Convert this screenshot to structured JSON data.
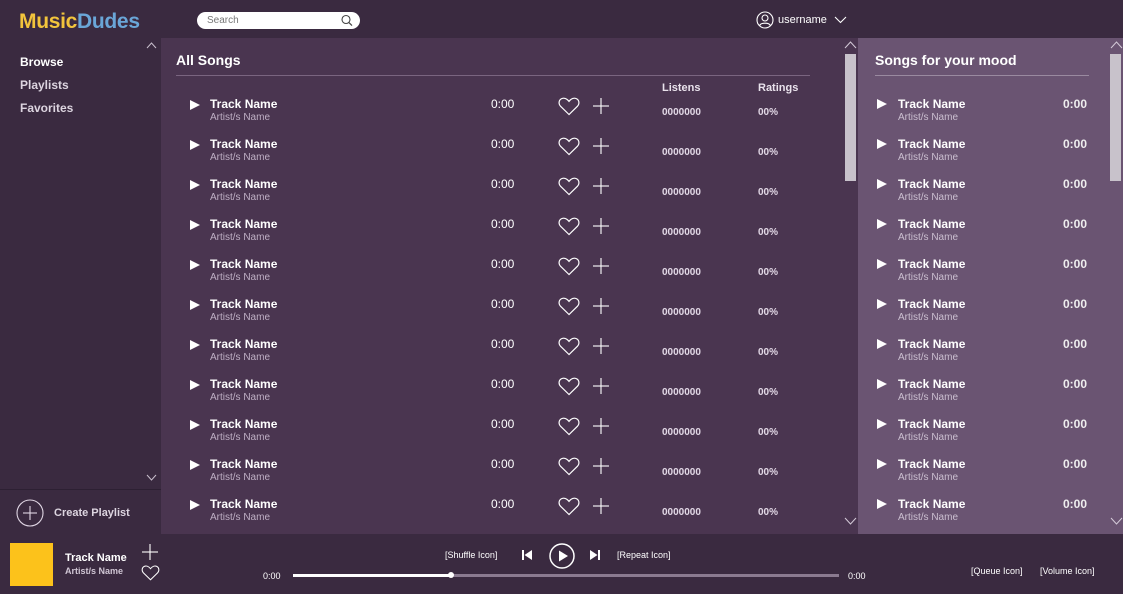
{
  "app": {
    "logo_part1": "Music",
    "logo_part2": "Dudes"
  },
  "colors": {
    "logo_music": "#f2c43c",
    "logo_dudes": "#6aa6d8",
    "album_art": "#fcc21b",
    "main_bg": "#4a3550",
    "mood_bg": "#6a5472"
  },
  "search": {
    "placeholder": "Search",
    "icon": "search-icon"
  },
  "user": {
    "name": "username",
    "icon": "user-icon"
  },
  "sidebar": {
    "items": [
      {
        "label": "Browse",
        "active": true
      },
      {
        "label": "Playlists",
        "active": false
      },
      {
        "label": "Favorites",
        "active": false
      }
    ],
    "create_label": "Create Playlist"
  },
  "main": {
    "title": "All Songs",
    "columns": {
      "listens": "Listens",
      "ratings": "Ratings"
    },
    "rows": [
      {
        "track": "Track Name",
        "artist": "Artist/s Name",
        "duration": "0:00",
        "listens": "0000000",
        "rating": "00%"
      },
      {
        "track": "Track Name",
        "artist": "Artist/s Name",
        "duration": "0:00",
        "listens": "0000000",
        "rating": "00%"
      },
      {
        "track": "Track Name",
        "artist": "Artist/s Name",
        "duration": "0:00",
        "listens": "0000000",
        "rating": "00%"
      },
      {
        "track": "Track Name",
        "artist": "Artist/s Name",
        "duration": "0:00",
        "listens": "0000000",
        "rating": "00%"
      },
      {
        "track": "Track Name",
        "artist": "Artist/s Name",
        "duration": "0:00",
        "listens": "0000000",
        "rating": "00%"
      },
      {
        "track": "Track Name",
        "artist": "Artist/s Name",
        "duration": "0:00",
        "listens": "0000000",
        "rating": "00%"
      },
      {
        "track": "Track Name",
        "artist": "Artist/s Name",
        "duration": "0:00",
        "listens": "0000000",
        "rating": "00%"
      },
      {
        "track": "Track Name",
        "artist": "Artist/s Name",
        "duration": "0:00",
        "listens": "0000000",
        "rating": "00%"
      },
      {
        "track": "Track Name",
        "artist": "Artist/s Name",
        "duration": "0:00",
        "listens": "0000000",
        "rating": "00%"
      },
      {
        "track": "Track Name",
        "artist": "Artist/s Name",
        "duration": "0:00",
        "listens": "0000000",
        "rating": "00%"
      },
      {
        "track": "Track Name",
        "artist": "Artist/s Name",
        "duration": "0:00",
        "listens": "0000000",
        "rating": "00%"
      }
    ]
  },
  "mood": {
    "title": "Songs for your mood",
    "rows": [
      {
        "track": "Track Name",
        "artist": "Artist/s Name",
        "duration": "0:00"
      },
      {
        "track": "Track Name",
        "artist": "Artist/s Name",
        "duration": "0:00"
      },
      {
        "track": "Track Name",
        "artist": "Artist/s Name",
        "duration": "0:00"
      },
      {
        "track": "Track Name",
        "artist": "Artist/s Name",
        "duration": "0:00"
      },
      {
        "track": "Track Name",
        "artist": "Artist/s Name",
        "duration": "0:00"
      },
      {
        "track": "Track Name",
        "artist": "Artist/s Name",
        "duration": "0:00"
      },
      {
        "track": "Track Name",
        "artist": "Artist/s Name",
        "duration": "0:00"
      },
      {
        "track": "Track Name",
        "artist": "Artist/s Name",
        "duration": "0:00"
      },
      {
        "track": "Track Name",
        "artist": "Artist/s Name",
        "duration": "0:00"
      },
      {
        "track": "Track Name",
        "artist": "Artist/s Name",
        "duration": "0:00"
      },
      {
        "track": "Track Name",
        "artist": "Artist/s Name",
        "duration": "0:00"
      }
    ]
  },
  "player": {
    "track": "Track Name",
    "artist": "Artist/s Name",
    "shuffle_label": "[Shuffle Icon]",
    "repeat_label": "[Repeat Icon]",
    "queue_label": "[Queue Icon]",
    "volume_label": "[Volume Icon]",
    "time_current": "0:00",
    "time_total": "0:00",
    "progress_fraction": 0.29
  }
}
